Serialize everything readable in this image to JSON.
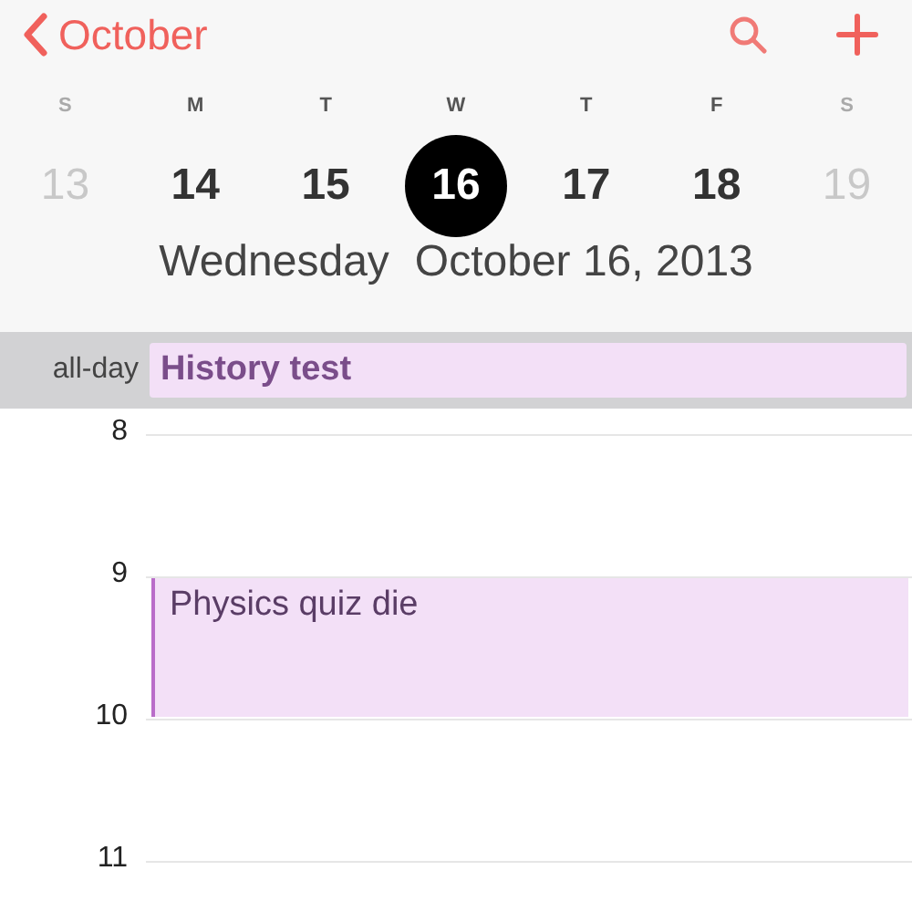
{
  "nav": {
    "back_label": "October"
  },
  "week": [
    {
      "letter": "S",
      "date": "13",
      "dimmed": true,
      "selected": false
    },
    {
      "letter": "M",
      "date": "14",
      "dimmed": false,
      "selected": false
    },
    {
      "letter": "T",
      "date": "15",
      "dimmed": false,
      "selected": false
    },
    {
      "letter": "W",
      "date": "16",
      "dimmed": false,
      "selected": true
    },
    {
      "letter": "T",
      "date": "17",
      "dimmed": false,
      "selected": false
    },
    {
      "letter": "F",
      "date": "18",
      "dimmed": false,
      "selected": false
    },
    {
      "letter": "S",
      "date": "19",
      "dimmed": true,
      "selected": false
    }
  ],
  "selected_date": {
    "weekday": "Wednesday",
    "date": "October 16, 2013"
  },
  "all_day": {
    "label": "all-day",
    "events": [
      {
        "title": "History test"
      }
    ]
  },
  "hours": [
    {
      "label": "8"
    },
    {
      "label": "9",
      "event": {
        "title": "Physics quiz die"
      }
    },
    {
      "label": "10"
    },
    {
      "label": "11"
    }
  ]
}
